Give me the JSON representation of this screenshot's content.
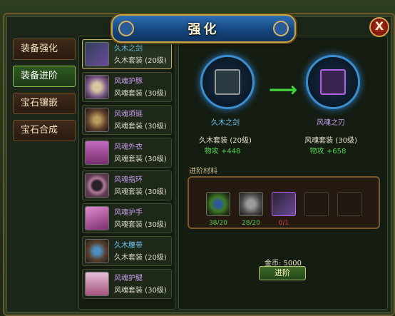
{
  "window": {
    "title": "强化",
    "close_label": "X"
  },
  "tabs": [
    {
      "label": "装备强化",
      "active": false
    },
    {
      "label": "装备进阶",
      "active": true
    },
    {
      "label": "宝石镶嵌",
      "active": false
    },
    {
      "label": "宝石合成",
      "active": false
    }
  ],
  "items": [
    {
      "name": "久木之剑",
      "set": "久木套装 (20级)",
      "name_color": "blue",
      "icon": "sword-icon"
    },
    {
      "name": "风魂护豚",
      "set": "风魂套装 (30级)",
      "name_color": "purple",
      "icon": "belt-icon"
    },
    {
      "name": "风魂项链",
      "set": "风魂套装 (30级)",
      "name_color": "purple",
      "icon": "necklace-icon"
    },
    {
      "name": "风魂外衣",
      "set": "风魂套装 (30级)",
      "name_color": "purple",
      "icon": "armor-icon"
    },
    {
      "name": "风魂指环",
      "set": "风魂套装 (30级)",
      "name_color": "purple",
      "icon": "ring-icon"
    },
    {
      "name": "风魂护手",
      "set": "风魂套装 (30级)",
      "name_color": "purple",
      "icon": "gauntlet-icon"
    },
    {
      "name": "久木腰带",
      "set": "久木套装 (20级)",
      "name_color": "blue",
      "icon": "waist-belt-icon"
    },
    {
      "name": "风魂护腿",
      "set": "风魂套装 (30级)",
      "name_color": "purple",
      "icon": "leggings-icon"
    }
  ],
  "upgrade": {
    "from": {
      "name": "久木之剑",
      "set": "久木套装 (20级)",
      "stat": "物攻 +448",
      "name_color": "#6fc4f3"
    },
    "to": {
      "name": "风魂之刃",
      "set": "风魂套装 (30级)",
      "stat": "物攻 +658",
      "name_color": "#c89cf0"
    },
    "arrow_icon": "right-arrow-icon"
  },
  "materials": {
    "label": "进阶材料",
    "slots": [
      {
        "icon": "herb-icon",
        "count": "38/20",
        "count_color": "#56d34e"
      },
      {
        "icon": "ore-icon",
        "count": "28/20",
        "count_color": "#56d34e"
      },
      {
        "icon": "sword-icon",
        "count": "0/1",
        "count_color": "#e04a3a"
      },
      {
        "icon": "empty-slot-icon",
        "count": ""
      },
      {
        "icon": "empty-slot-icon",
        "count": ""
      }
    ]
  },
  "cost": {
    "gold_text": "金币: 5000"
  },
  "action_button": {
    "label": "进阶"
  },
  "colors": {
    "frame_gold": "#c9a54a",
    "purple_name": "#c89cf0",
    "blue_name": "#6fc4f3",
    "stat_green": "#56d34e",
    "insufficient_red": "#e04a3a"
  }
}
